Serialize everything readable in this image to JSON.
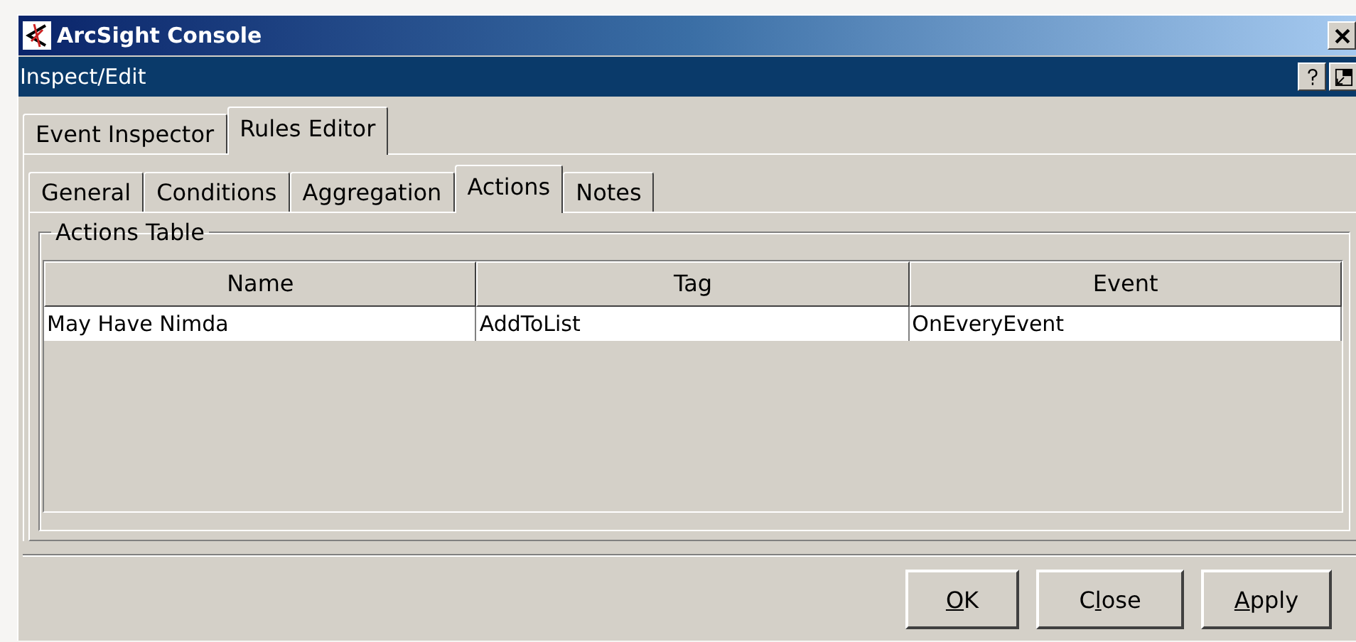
{
  "window": {
    "title": "ArcSight Console"
  },
  "panel": {
    "title": "Inspect/Edit"
  },
  "tabs": [
    {
      "label": "Event Inspector",
      "selected": false
    },
    {
      "label": "Rules Editor",
      "selected": true
    }
  ],
  "subtabs": [
    {
      "label": "General",
      "selected": false
    },
    {
      "label": "Conditions",
      "selected": false
    },
    {
      "label": "Aggregation",
      "selected": false
    },
    {
      "label": "Actions",
      "selected": true
    },
    {
      "label": "Notes",
      "selected": false
    }
  ],
  "group": {
    "title": "Actions Table"
  },
  "table": {
    "columns": [
      "Name",
      "Tag",
      "Event"
    ],
    "rows": [
      [
        "May Have Nimda",
        "AddToList",
        "OnEveryEvent"
      ]
    ]
  },
  "buttons": [
    {
      "key": "O",
      "post": "K"
    },
    {
      "pre": "C",
      "key": "l",
      "post": "ose"
    },
    {
      "key": "A",
      "post": "pply"
    }
  ]
}
